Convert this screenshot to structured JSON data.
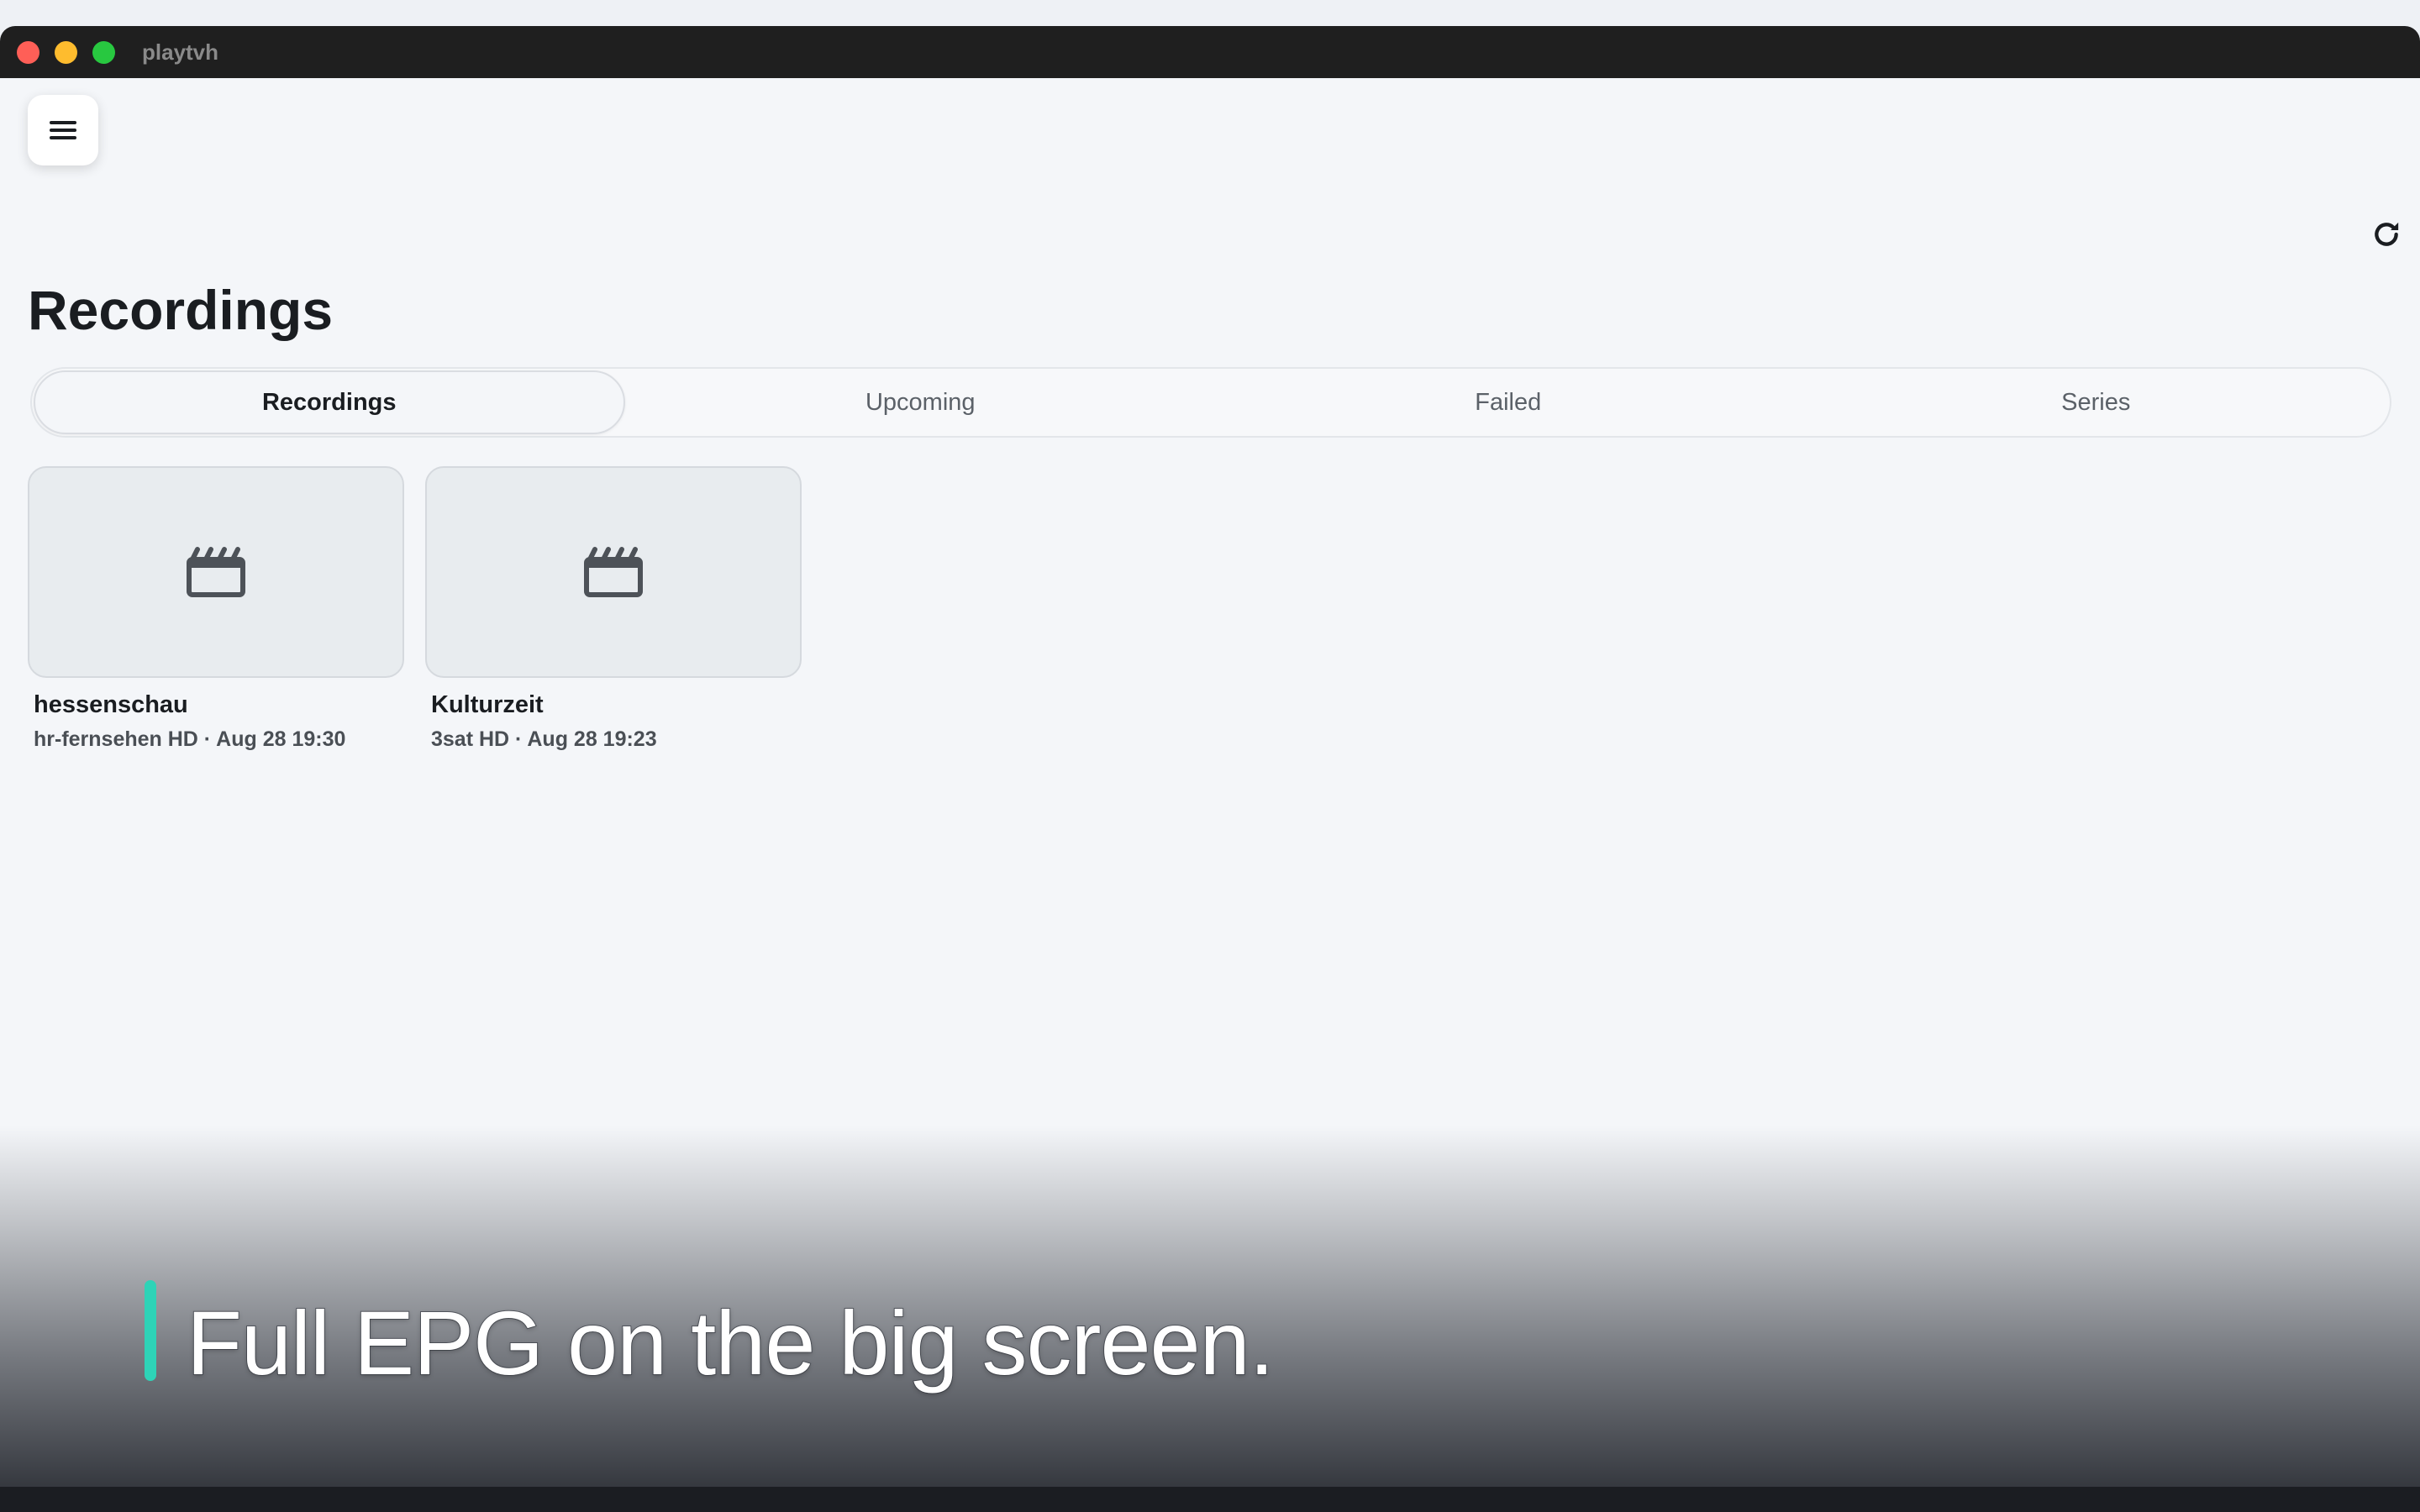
{
  "window": {
    "app_title": "playtvh"
  },
  "page": {
    "title": "Recordings"
  },
  "tabs": [
    {
      "label": "Recordings",
      "active": true
    },
    {
      "label": "Upcoming",
      "active": false
    },
    {
      "label": "Failed",
      "active": false
    },
    {
      "label": "Series",
      "active": false
    }
  ],
  "recordings": [
    {
      "title": "hessenschau",
      "meta": "hr-fernsehen HD · Aug 28 19:30",
      "icon": "clapperboard-icon"
    },
    {
      "title": "Kulturzeit",
      "meta": "3sat HD · Aug 28 19:23",
      "icon": "clapperboard-icon"
    }
  ],
  "caption": {
    "text": "Full EPG on the big screen.",
    "accent_color": "#2ed3b7"
  },
  "icons": {
    "menu": "hamburger-menu-icon",
    "refresh": "refresh-icon"
  },
  "colors": {
    "titlebar": "#1f1f1f",
    "background": "#f4f6f9",
    "close": "#ff5f57",
    "minimize": "#febc2e",
    "maximize": "#28c840"
  }
}
